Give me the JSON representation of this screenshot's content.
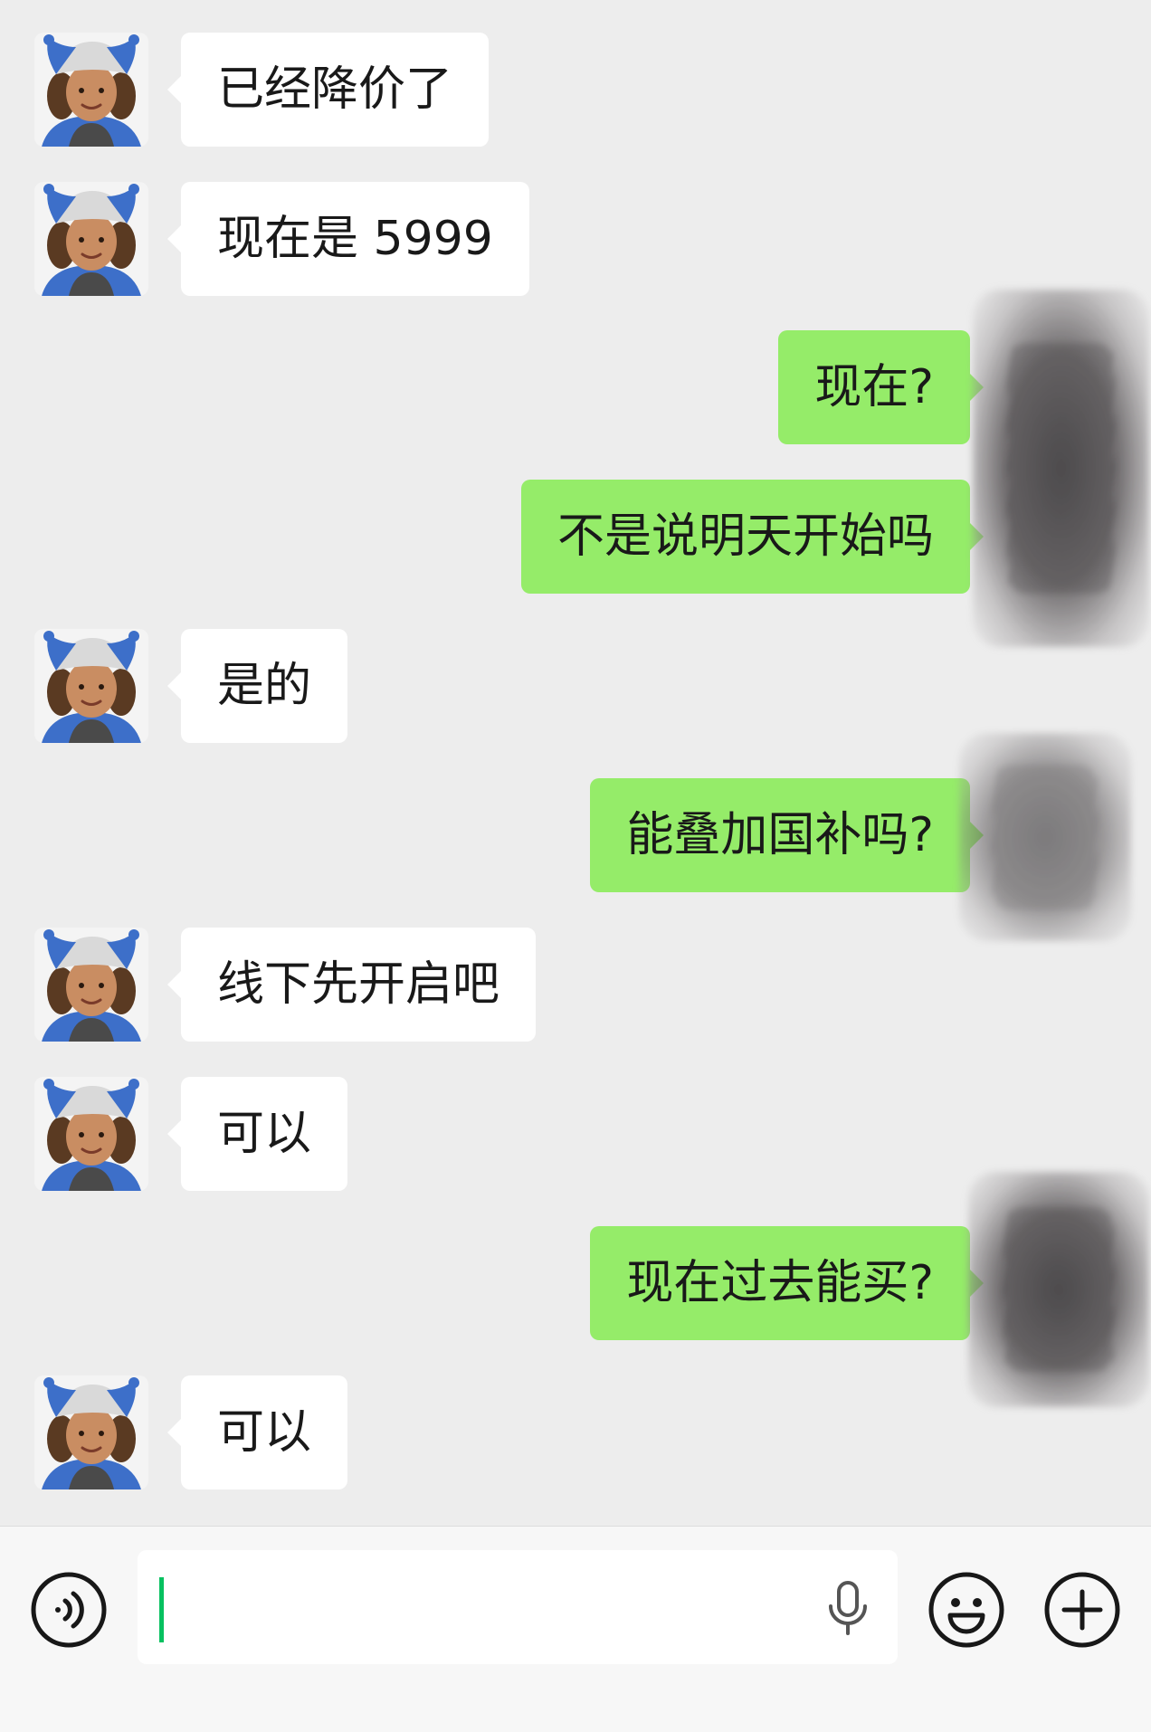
{
  "messages": [
    {
      "side": "in",
      "text": "已经降价了"
    },
    {
      "side": "in",
      "text": "现在是 5999"
    },
    {
      "side": "out",
      "text": "现在?"
    },
    {
      "side": "out",
      "text": "不是说明天开始吗"
    },
    {
      "side": "in",
      "text": "是的"
    },
    {
      "side": "out",
      "text": "能叠加国补吗?"
    },
    {
      "side": "in",
      "text": "线下先开启吧"
    },
    {
      "side": "in",
      "text": "可以"
    },
    {
      "side": "out",
      "text": "现在过去能买?"
    },
    {
      "side": "in",
      "text": "可以"
    }
  ],
  "input": {
    "value": ""
  },
  "icons": {
    "voice": "voice-icon",
    "mic": "microphone-icon",
    "emoji": "emoji-icon",
    "more": "plus-icon"
  },
  "colors": {
    "background": "#ededed",
    "incoming_bubble": "#ffffff",
    "outgoing_bubble": "#95ec69",
    "caret": "#07c160"
  }
}
